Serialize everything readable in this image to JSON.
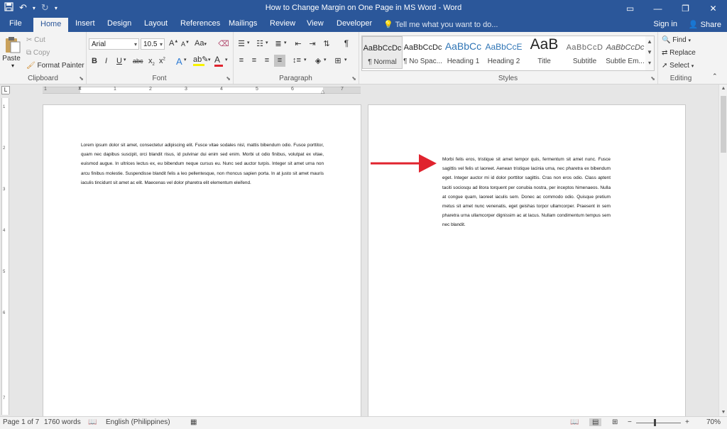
{
  "window": {
    "title": "How to Change Margin on One Page in MS Word - Word",
    "controls": [
      "ribbon-display-options-icon",
      "minimize-icon",
      "restore-icon",
      "close-icon"
    ]
  },
  "qat": {
    "save": "save-icon",
    "undo": "undo-icon",
    "redo": "redo-icon",
    "customize": "customize-qat-icon"
  },
  "tabs": {
    "file": "File",
    "home": "Home",
    "insert": "Insert",
    "design": "Design",
    "layout": "Layout",
    "references": "References",
    "mailings": "Mailings",
    "review": "Review",
    "view": "View",
    "developer": "Developer"
  },
  "tellme": "Tell me what you want to do...",
  "signin": "Sign in",
  "share": "Share",
  "clipboard": {
    "paste": "Paste",
    "cut": "Cut",
    "copy": "Copy",
    "format_painter": "Format Painter",
    "label": "Clipboard"
  },
  "font": {
    "name": "Arial",
    "size": "10.5",
    "label": "Font",
    "grow": "A",
    "shrink": "A",
    "case": "Aa",
    "bold": "B",
    "italic": "I",
    "underline": "U",
    "strike": "abc",
    "sub": "x",
    "sup": "x",
    "effects": "A",
    "color": "A"
  },
  "paragraph": {
    "label": "Paragraph"
  },
  "styles": {
    "label": "Styles",
    "items": [
      {
        "sample": "AaBbCcDc",
        "name": "¶ Normal"
      },
      {
        "sample": "AaBbCcDc",
        "name": "¶ No Spac..."
      },
      {
        "sample": "AaBbCc",
        "name": "Heading 1"
      },
      {
        "sample": "AaBbCcE",
        "name": "Heading 2"
      },
      {
        "sample": "AaB",
        "name": "Title"
      },
      {
        "sample": "AaBbCcD",
        "name": "Subtitle"
      },
      {
        "sample": "AaBbCcDc",
        "name": "Subtle Em..."
      }
    ]
  },
  "editing": {
    "find": "Find",
    "replace": "Replace",
    "select": "Select",
    "label": "Editing"
  },
  "ruler": {
    "numbers": [
      "1",
      "1",
      "2",
      "3",
      "4",
      "5",
      "6",
      "7"
    ]
  },
  "vruler": {
    "numbers": [
      "1",
      "2",
      "3",
      "4",
      "5",
      "6",
      "7"
    ]
  },
  "page1": {
    "text": "Lorem ipsum dolor sit amet, consectetur adipiscing elit. Fusce vitae sodales nisl, mattis bibendum odio. Fusce porttitor, quam nec dapibus suscipit, orci blandit risus, id pulvinar dui enim sed enim. Morbi ut odio finibus, volutpat ex vitae, euismod augue. In ultrices lectus ex, eu bibendum neque cursus eu. Nunc sed auctor turpis. Integer sit amet urna non arcu finibus molestie. Suspendisse blandit felis a leo pellentesque, non rhoncus sapien porta. In at justo sit amet mauris iaculis tincidunt sit amet ac elit. Maecenas vel dolor pharetra elit elementum eleifend."
  },
  "page2": {
    "text": "Morbi felis eros, tristique sit amet tempor quis, fermentum sit amet nunc. Fusce sagittis vel felis ut laoreet. Aenean tristique lacinia urna, nec pharetra ex bibendum eget. Integer auctor mi id dolor porttitor sagittis. Cras non eros odio. Class aptent taciti sociosqu ad litora torquent per conubia nostra, per inceptos himenaeos. Nulla at congue quam, laoreet iaculis sem. Donec ac commodo odio. Quisque pretium metus sit amet nunc venenatis, eget geishas torpor ullamcorper. Praesent in sem pharetra urna ullamcorper dignissim ac at lacus. Nullam condimentum tempus sem nec blandit."
  },
  "annotation": {
    "arrow_color": "#e0232e"
  },
  "status": {
    "page": "Page 1 of 7",
    "words": "1760 words",
    "language": "English (Philippines)",
    "zoom": "70%",
    "zoom_minus": "−",
    "zoom_plus": "+"
  },
  "colors": {
    "accent": "#2b579a"
  }
}
